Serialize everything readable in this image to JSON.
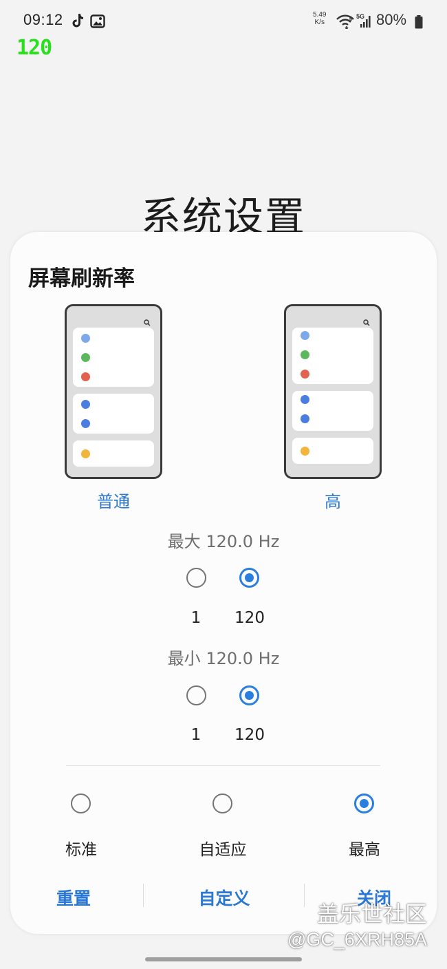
{
  "status_bar": {
    "time": "09:12",
    "icons": [
      "tiktok-icon",
      "image-icon",
      "wifi-icon",
      "5g-signal-icon",
      "battery-icon"
    ],
    "net_speed_value": "5.49",
    "net_speed_unit": "K/s",
    "network_type": "5G",
    "battery": "80%"
  },
  "fps_counter": "120",
  "page_title": "系统设置",
  "dialog": {
    "title": "屏幕刷新率",
    "preview_normal_label": "普通",
    "preview_high_label": "高",
    "max_caption": "最大 120.0 Hz",
    "max_options": [
      {
        "label": "1",
        "selected": false
      },
      {
        "label": "120",
        "selected": true
      }
    ],
    "min_caption": "最小 120.0 Hz",
    "min_options": [
      {
        "label": "1",
        "selected": false
      },
      {
        "label": "120",
        "selected": true
      }
    ],
    "modes": [
      {
        "label": "标准",
        "selected": false
      },
      {
        "label": "自适应",
        "selected": false
      },
      {
        "label": "最高",
        "selected": true
      }
    ],
    "buttons": {
      "reset": "重置",
      "custom": "自定义",
      "close": "关闭"
    }
  },
  "watermark": {
    "site": "盖乐世社区",
    "user": "@GC_6XRH85A"
  },
  "colors": {
    "accent": "#2a7ee0",
    "fps_green": "#29e01d",
    "dot_light_blue": "#7da8ea",
    "dot_green": "#5cb85c",
    "dot_red": "#e2624f",
    "dot_blue": "#4a7de0",
    "dot_yellow": "#f2b43a"
  }
}
